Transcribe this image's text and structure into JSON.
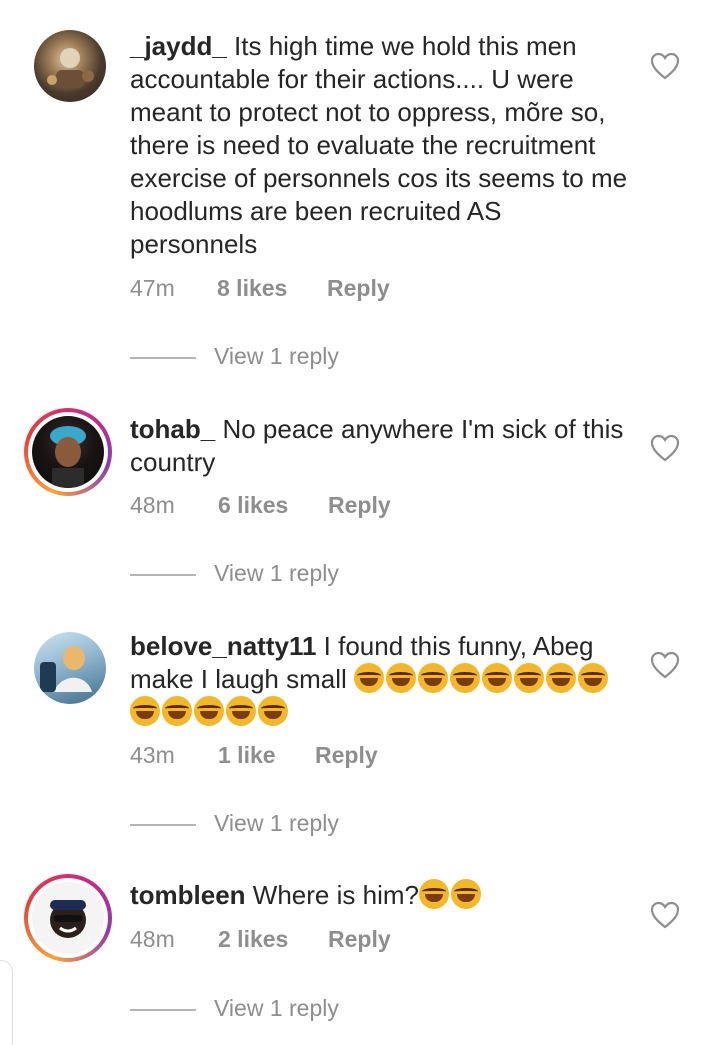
{
  "comments": [
    {
      "username": "_jaydd_",
      "text": " Its high time we hold this men accountable for their actions.... U were meant to protect not to oppress, mõre so, there is need to evaluate the recruitment exercise of personnels cos its seems to me hoodlums are been recruited AS personnels",
      "time": "47m",
      "likes": "8 likes",
      "reply": "Reply",
      "view_replies": "View 1 reply"
    },
    {
      "username": "tohab_",
      "text": " No peace anywhere I'm sick of this country",
      "time": "48m",
      "likes": "6 likes",
      "reply": "Reply",
      "view_replies": "View 1 reply"
    },
    {
      "username": "belove_natty11",
      "text": " I found this funny, Abeg make I laugh small ",
      "emoji_count": 13,
      "time": "43m",
      "likes": "1 like",
      "reply": "Reply",
      "view_replies": "View 1 reply"
    },
    {
      "username": "tombleen",
      "text": " Where is him?",
      "emoji_count": 2,
      "time": "48m",
      "likes": "2 likes",
      "reply": "Reply",
      "view_replies": "View 1 reply"
    }
  ],
  "icons": {
    "like": "heart-outline-icon",
    "emoji": "laughing-emoji-icon"
  },
  "colors": {
    "text": "#262626",
    "muted": "#8e8e8e",
    "emoji": "#f5b72a"
  }
}
